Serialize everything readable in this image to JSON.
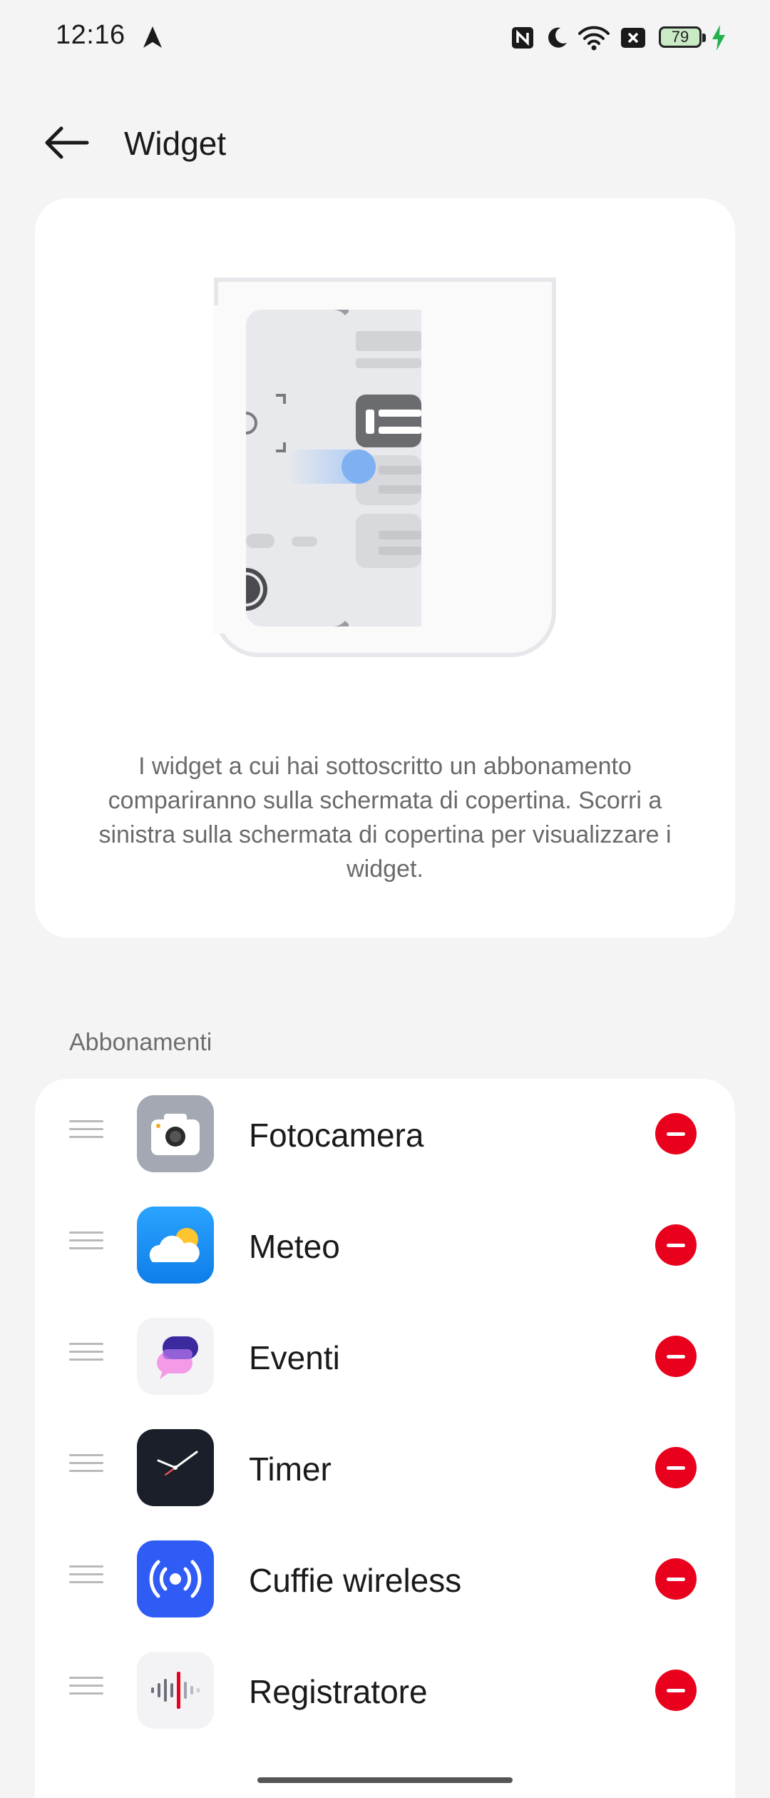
{
  "status_bar": {
    "time": "12:16",
    "battery": "79",
    "icons": [
      "navigation-arrow-icon",
      "nfc-icon",
      "do-not-disturb-moon-icon",
      "wifi-icon",
      "no-sim-icon",
      "battery-icon",
      "charging-bolt-icon"
    ]
  },
  "header": {
    "title": "Widget",
    "back_icon": "back-arrow-icon"
  },
  "hero": {
    "description": "I widget a cui hai sottoscritto un abbonamento compariranno sulla schermata di copertina. Scorri a sinistra sulla schermata di copertina per visualizzare i widget."
  },
  "subscriptions": {
    "section_title": "Abbonamenti",
    "items": [
      {
        "label": "Fotocamera",
        "icon": "camera-icon"
      },
      {
        "label": "Meteo",
        "icon": "weather-icon"
      },
      {
        "label": "Eventi",
        "icon": "events-icon"
      },
      {
        "label": "Timer",
        "icon": "clock-icon"
      },
      {
        "label": "Cuffie wireless",
        "icon": "wireless-earbuds-icon"
      },
      {
        "label": "Registratore",
        "icon": "recorder-icon"
      }
    ]
  },
  "colors": {
    "remove": "#e8001c",
    "background": "#f4f4f4",
    "card": "#ffffff"
  }
}
